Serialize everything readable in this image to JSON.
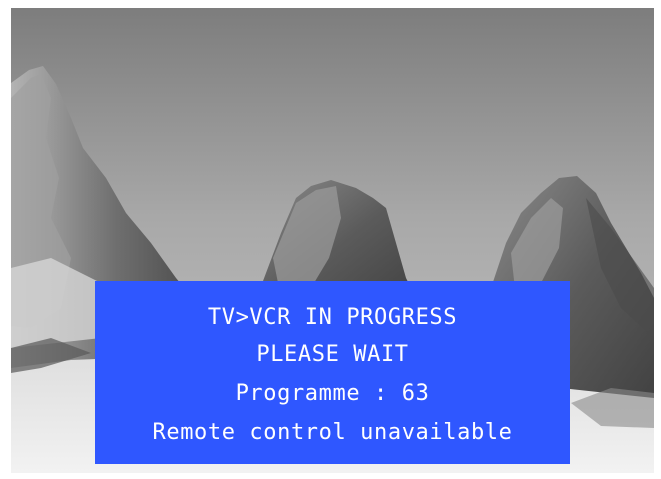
{
  "screen": {
    "background_scene": "mountain-peaks-image",
    "osd": {
      "line1": "TV>VCR IN PROGRESS",
      "line2": "PLEASE WAIT",
      "line3": "Programme : 63",
      "line4": "Remote control unavailable",
      "background_color": "#2f57ff",
      "text_color": "#ffffff"
    }
  }
}
